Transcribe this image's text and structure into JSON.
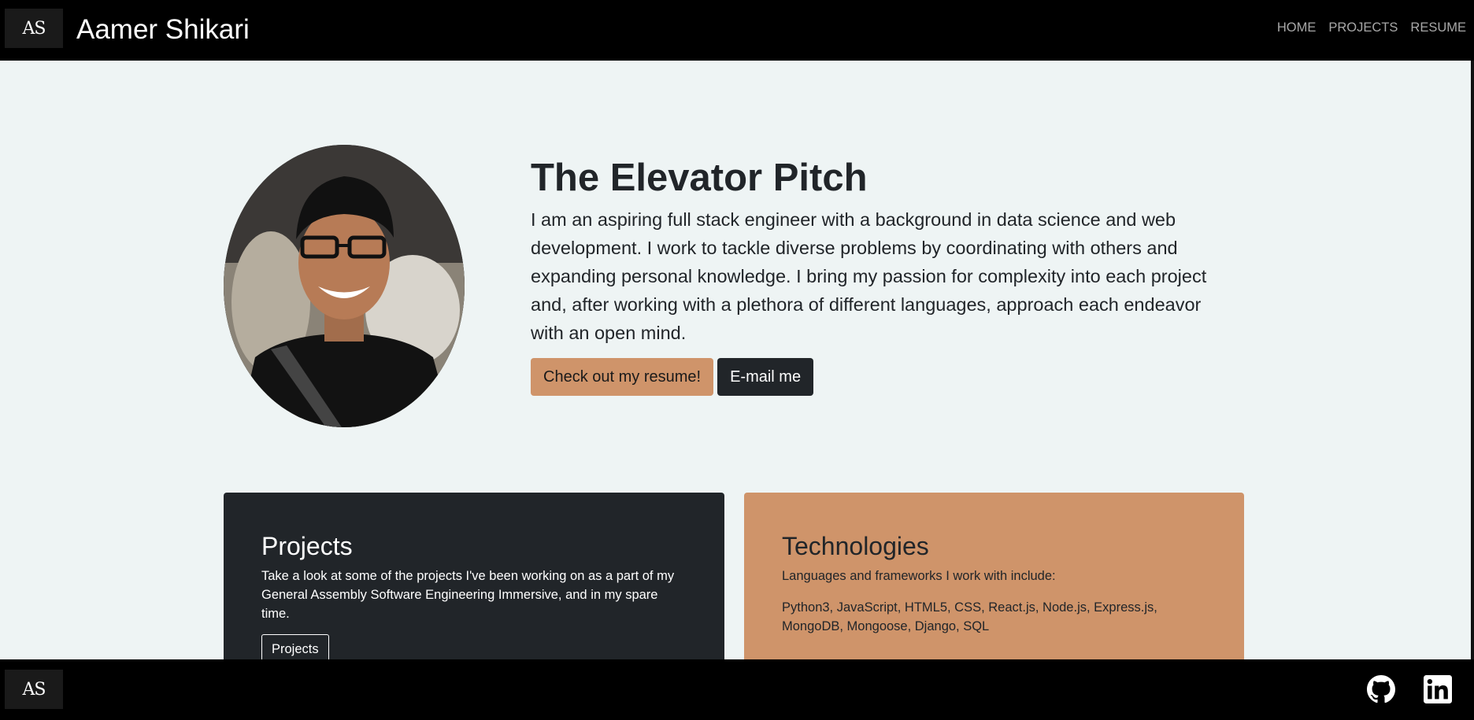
{
  "navbar": {
    "logo_text": "AS",
    "brand": "Aamer Shikari",
    "links": [
      "HOME",
      "PROJECTS",
      "RESUME"
    ]
  },
  "hero": {
    "title": "The Elevator Pitch",
    "body": "I am an aspiring full stack engineer with a background in data science and web development. I work to tackle diverse problems by coordinating with others and expanding personal knowledge. I bring my passion for complexity into each project and, after working with a plethora of different languages, approach each endeavor with an open mind.",
    "resume_button": "Check out my resume!",
    "email_button": "E-mail me"
  },
  "projects_card": {
    "title": "Projects",
    "text": "Take a look at some of the projects I've been working on as a part of my General Assembly Software Engineering Immersive, and in my spare time.",
    "button": "Projects"
  },
  "tech_card": {
    "title": "Technologies",
    "intro": "Languages and frameworks I work with include:",
    "list": "Python3, JavaScript, HTML5, CSS, React.js, Node.js, Express.js, MongoDB, Mongoose, Django, SQL"
  },
  "footer": {
    "logo_text": "AS",
    "icons": [
      "github-icon",
      "linkedin-icon"
    ]
  },
  "colors": {
    "accent": "#cf946a",
    "dark": "#212529",
    "background": "#eef4f4",
    "bar": "#000000"
  }
}
